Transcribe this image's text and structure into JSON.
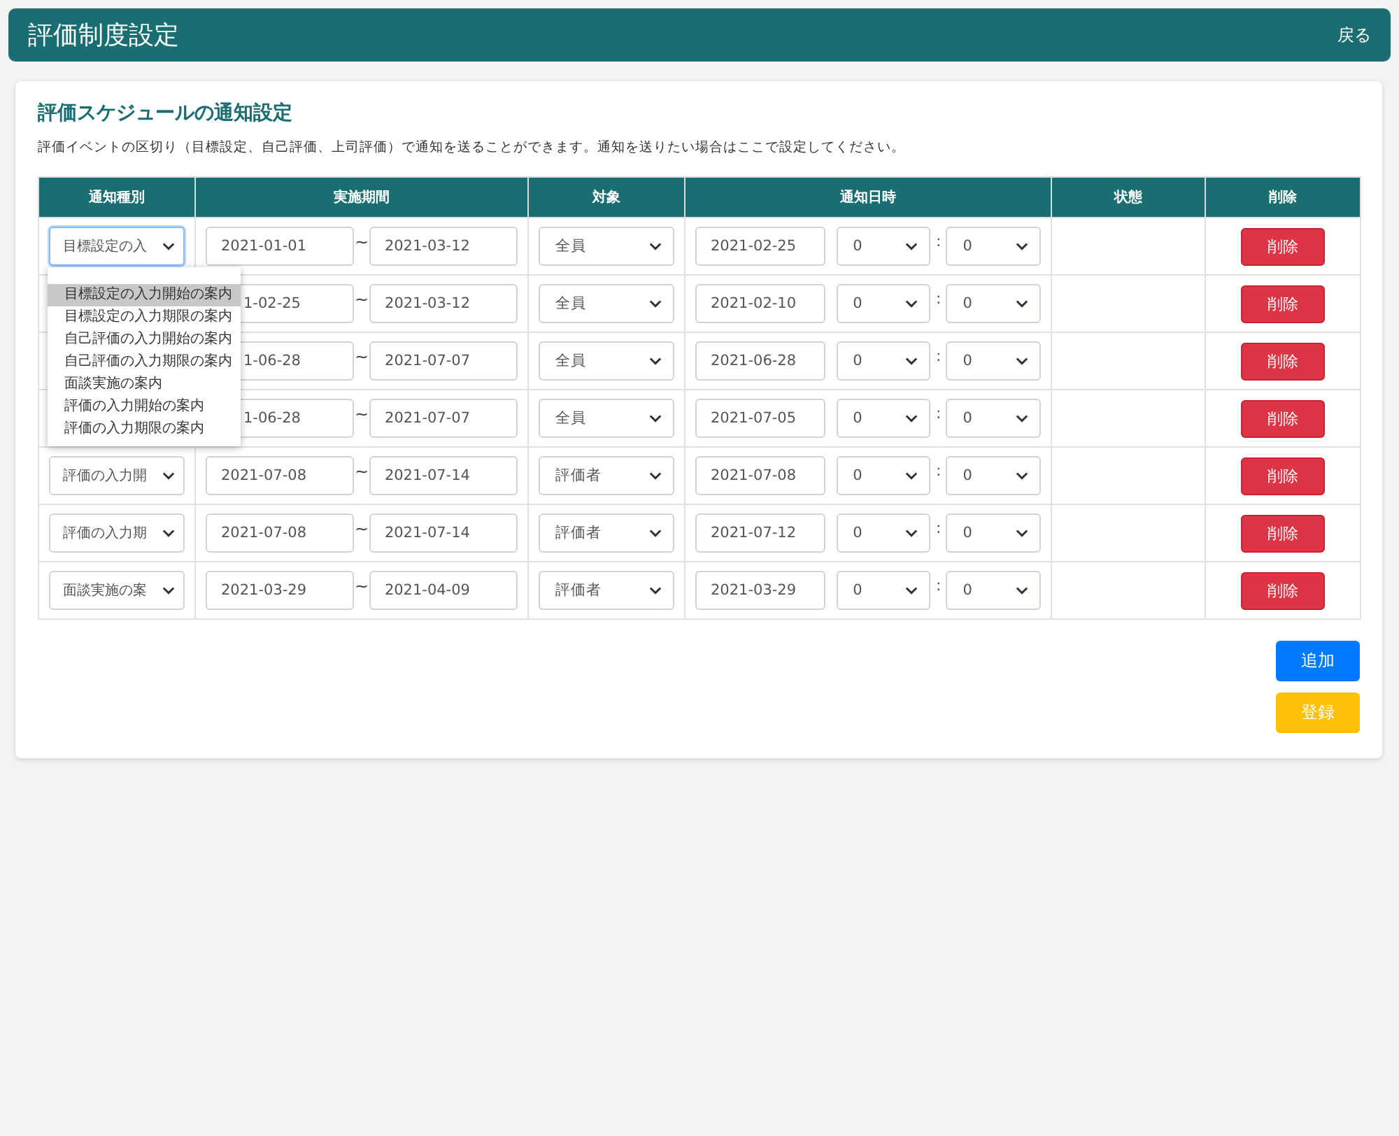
{
  "header": {
    "title": "評価制度設定",
    "back": "戻る"
  },
  "section": {
    "title": "評価スケジュールの通知設定",
    "description": "評価イベントの区切り（目標設定、自己評価、上司評価）で通知を送ることができます。通知を送りたい場合はここで設定してください。"
  },
  "table": {
    "columns": [
      "通知種別",
      "実施期間",
      "対象",
      "通知日時",
      "状態",
      "削除"
    ],
    "rows": [
      {
        "type": {
          "value": "目標設定の入",
          "open": true,
          "options": [
            {
              "label": "目標設定の入力開始の案内",
              "selected": true
            },
            {
              "label": "目標設定の入力期限の案内",
              "selected": false
            },
            {
              "label": "自己評価の入力開始の案内",
              "selected": false
            },
            {
              "label": "自己評価の入力期限の案内",
              "selected": false
            },
            {
              "label": "面談実施の案内",
              "selected": false
            },
            {
              "label": "評価の入力開始の案内",
              "selected": false
            },
            {
              "label": "評価の入力期限の案内",
              "selected": false
            }
          ]
        },
        "start": "2021-01-01",
        "tilde": "~",
        "end": "2021-03-12",
        "target": "全員",
        "date": "2021-02-25",
        "hour": "0",
        "colon": ":",
        "minute": "0",
        "delete": "削除"
      },
      {
        "start": "1-02-25",
        "tilde": "~",
        "end": "2021-03-12",
        "target": "全員",
        "date": "2021-02-10",
        "hour": "0",
        "colon": ":",
        "minute": "0",
        "delete": "削除"
      },
      {
        "start": "1-06-28",
        "tilde": "~",
        "end": "2021-07-07",
        "target": "全員",
        "date": "2021-06-28",
        "hour": "0",
        "colon": ":",
        "minute": "0",
        "delete": "削除"
      },
      {
        "start": "1-06-28",
        "tilde": "~",
        "end": "2021-07-07",
        "target": "全員",
        "date": "2021-07-05",
        "hour": "0",
        "colon": ":",
        "minute": "0",
        "delete": "削除"
      },
      {
        "type": {
          "value": "評価の入力開",
          "open": false
        },
        "start": "2021-07-08",
        "tilde": "~",
        "end": "2021-07-14",
        "target": "評価者",
        "date": "2021-07-08",
        "hour": "0",
        "colon": ":",
        "minute": "0",
        "delete": "削除"
      },
      {
        "type": {
          "value": "評価の入力期",
          "open": false
        },
        "start": "2021-07-08",
        "tilde": "~",
        "end": "2021-07-14",
        "target": "評価者",
        "date": "2021-07-12",
        "hour": "0",
        "colon": ":",
        "minute": "0",
        "delete": "削除"
      },
      {
        "type": {
          "value": "面談実施の案",
          "open": false
        },
        "start": "2021-03-29",
        "tilde": "~",
        "end": "2021-04-09",
        "target": "評価者",
        "date": "2021-03-29",
        "hour": "0",
        "colon": ":",
        "minute": "0",
        "delete": "削除"
      }
    ]
  },
  "buttons": [
    {
      "kind": "add",
      "label": "追加"
    },
    {
      "kind": "save",
      "label": "登録"
    }
  ]
}
